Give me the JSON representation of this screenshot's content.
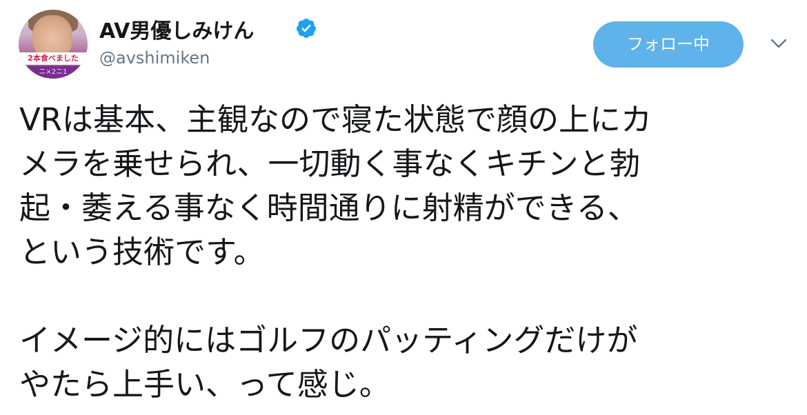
{
  "user": {
    "display_name": "AV男優しみけん",
    "handle": "@avshimiken",
    "verified": true,
    "avatar_caption_top": "2本食べました",
    "avatar_caption_bottom": "ニ×2ニ1"
  },
  "actions": {
    "follow_label": "フォロー中",
    "menu_icon": "chevron-down-icon"
  },
  "tweet": {
    "lines_paragraph_1": [
      "VRは基本、主観なので寝た状態で顔の上にカ",
      "メラを乗せられ、一切動く事なくキチンと勃",
      "起・萎える事なく時間通りに射精ができる、",
      "という技術です。"
    ],
    "lines_paragraph_2": [
      "イメージ的にはゴルフのパッティングだけが",
      "やたら上手い、って感じ。"
    ]
  },
  "colors": {
    "follow_button": "#5fb2ea",
    "verified_badge": "#1da1f2",
    "handle_text": "#657786",
    "body_text": "#14171a"
  }
}
